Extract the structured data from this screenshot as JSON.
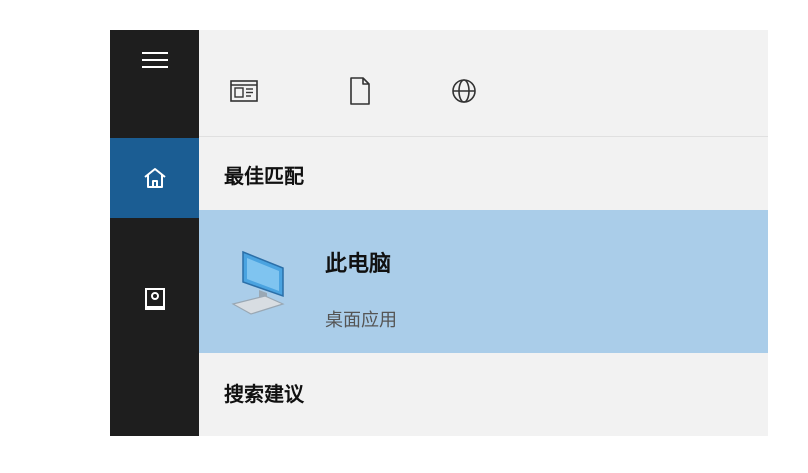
{
  "rail": {
    "menu_icon": "hamburger-menu-icon",
    "home_icon": "home-icon",
    "notebook_icon": "notebook-icon"
  },
  "toolbar": {
    "filters": [
      {
        "icon": "apps-filter-icon"
      },
      {
        "icon": "document-filter-icon"
      },
      {
        "icon": "globe-filter-icon"
      }
    ]
  },
  "best_match": {
    "header": "最佳匹配",
    "result": {
      "title": "此电脑",
      "subtitle": "桌面应用",
      "icon": "this-pc-monitor-icon"
    }
  },
  "suggestions": {
    "header": "搜索建议"
  },
  "colors": {
    "rail_bg": "#1e1e1e",
    "rail_active": "#1b5d93",
    "pane_bg": "#f2f2f2",
    "selected_bg": "#aacde9"
  }
}
